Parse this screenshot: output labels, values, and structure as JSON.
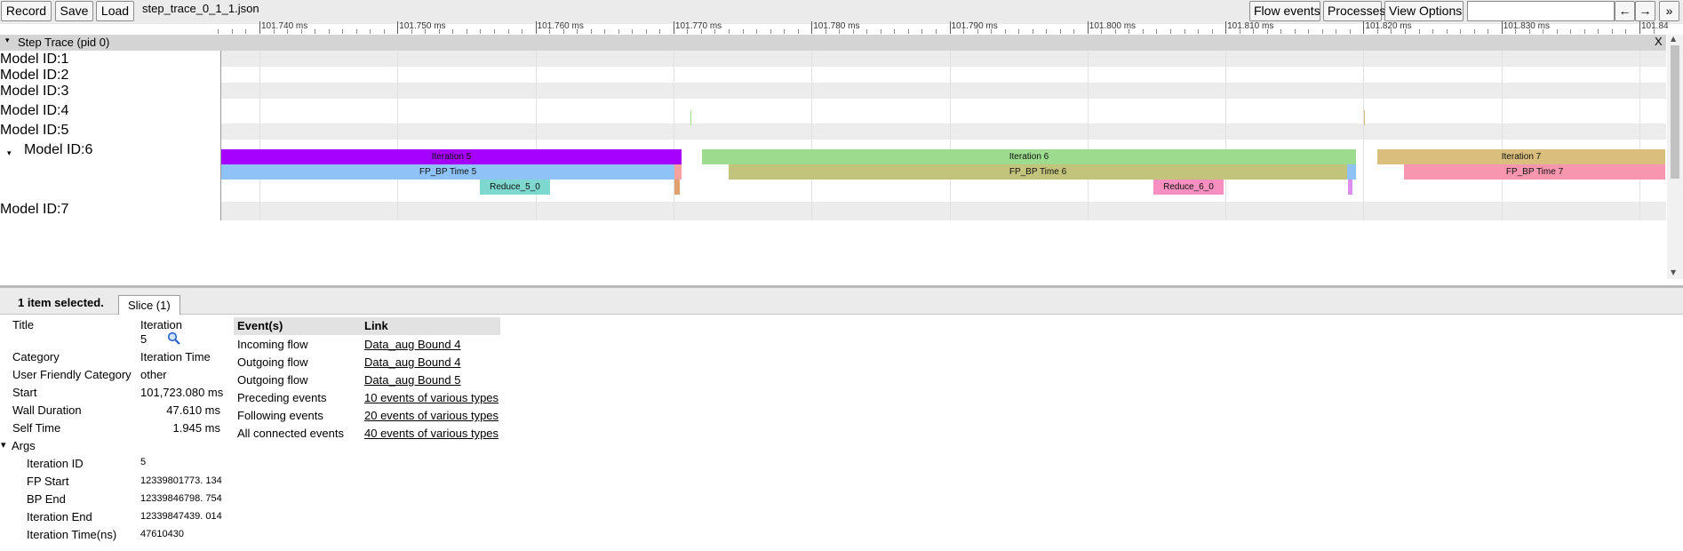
{
  "toolbar": {
    "record_label": "Record",
    "save_label": "Save",
    "load_label": "Load",
    "file_name": "step_trace_0_1_1.json",
    "flow_events_label": "Flow events",
    "processes_label": "Processes",
    "view_options_label": "View Options",
    "search_value": "",
    "prev_label": "←",
    "next_label": "→",
    "more_label": "»"
  },
  "ruler": {
    "ticks": [
      "101.740 ms",
      "101.750 ms",
      "101.760 ms",
      "101.770 ms",
      "101.780 ms",
      "101.790 ms",
      "101.800 ms",
      "101.810 ms",
      "101.820 ms",
      "101.830 ms",
      "101.84"
    ]
  },
  "process": {
    "title": "Step Trace (pid 0)",
    "close_label": "X",
    "toggle_icon": "▾"
  },
  "tracks": [
    {
      "label": "Model ID:1"
    },
    {
      "label": "Model ID:2"
    },
    {
      "label": "Model ID:3"
    },
    {
      "label": "Model ID:4"
    },
    {
      "label": "Model ID:5"
    },
    {
      "label": "Model ID:6",
      "expanded_icon": "▾"
    },
    {
      "label": "Model ID:7"
    }
  ],
  "slices": {
    "iteration_5": "Iteration 5",
    "iteration_6": "Iteration 6",
    "iteration_7": "Iteration 7",
    "fp_bp_5": "FP_BP Time 5",
    "fp_bp_6": "FP_BP Time 6",
    "fp_bp_7": "FP_BP Time 7",
    "reduce_5": "Reduce_5_0",
    "reduce_6": "Reduce_6_0"
  },
  "colors": {
    "iteration_5": "#a600ff",
    "iteration_6": "#9ddc8f",
    "iteration_7": "#d9be7e",
    "fp_bp_5": "#8fc3f7",
    "fp_bp_6": "#c2c47c",
    "fp_bp_7": "#f796ae",
    "reduce_5": "#7fd8d0",
    "reduce_6": "#f78fc1"
  },
  "panel": {
    "selection_count": "1 item selected.",
    "tab_label": "Slice (1)",
    "props": {
      "title_label": "Title",
      "title_value_line1": "Iteration",
      "title_value_line2": "5",
      "category_label": "Category",
      "category_value": "Iteration Time",
      "ufc_label": "User Friendly Category",
      "ufc_value": "other",
      "start_label": "Start",
      "start_value": "101,723.080 ms",
      "wall_label": "Wall Duration",
      "wall_value": "47.610 ms",
      "self_label": "Self Time",
      "self_value": "1.945 ms",
      "args_label": "Args",
      "args_toggle": "▾"
    },
    "args": [
      {
        "key": "Iteration ID",
        "value": "5"
      },
      {
        "key": "FP Start",
        "value": "12339801773. 134"
      },
      {
        "key": "BP End",
        "value": "12339846798. 754"
      },
      {
        "key": "Iteration End",
        "value": "12339847439. 014"
      },
      {
        "key": "Iteration Time(ns)",
        "value": "47610430"
      }
    ],
    "events_table": {
      "col_events": "Event(s)",
      "col_link": "Link",
      "rows": [
        {
          "event": "Incoming flow",
          "link": "Data_aug Bound 4"
        },
        {
          "event": "Outgoing flow",
          "link": "Data_aug Bound 4"
        },
        {
          "event": "Outgoing flow",
          "link": "Data_aug Bound 5"
        },
        {
          "event": "Preceding events",
          "link": "10 events of various types"
        },
        {
          "event": "Following events",
          "link": "20 events of various types"
        },
        {
          "event": "All connected events",
          "link": "40 events of various types"
        }
      ]
    }
  }
}
